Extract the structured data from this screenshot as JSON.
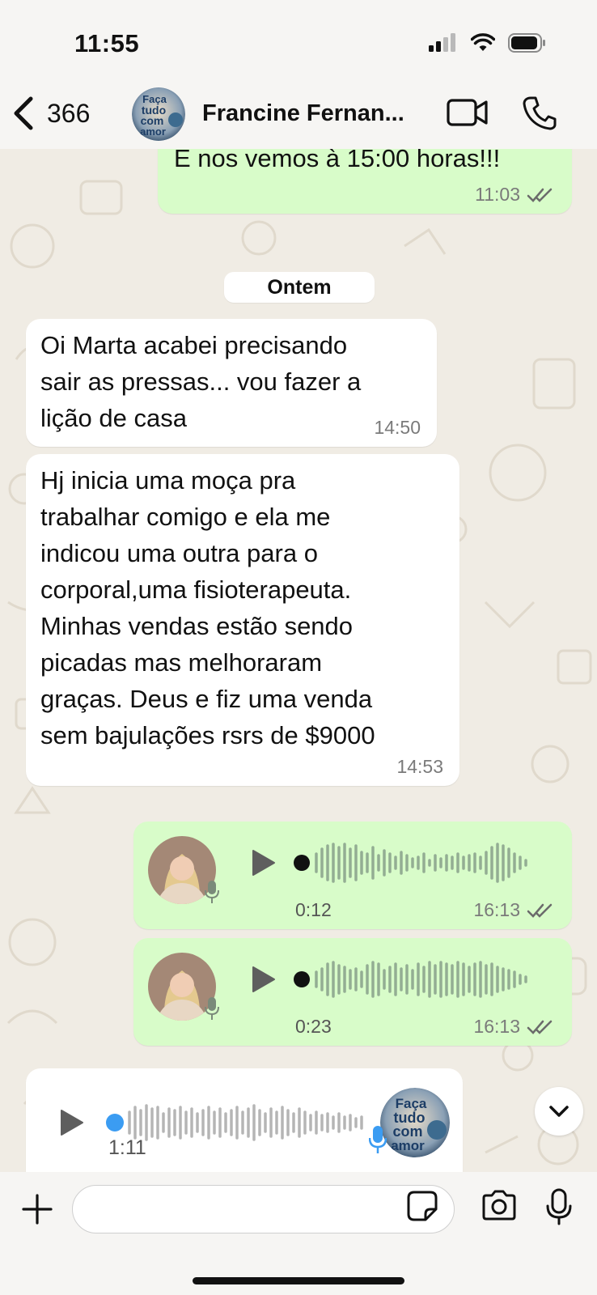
{
  "status_bar": {
    "time": "11:55"
  },
  "header": {
    "back_count": "366",
    "contact_name": "Francine Fernan...",
    "avatar_text": "Faça tudo com amor"
  },
  "messages": [
    {
      "id": "m1",
      "direction": "out",
      "text": "E nos vemos à 15:00 horas!!!",
      "time": "11:03",
      "status": "read"
    },
    {
      "id": "date",
      "label": "Ontem"
    },
    {
      "id": "m2",
      "direction": "in",
      "lines": [
        "Oi Marta acabei precisando",
        "sair as pressas... vou fazer a",
        "lição de casa"
      ],
      "time": "14:50"
    },
    {
      "id": "m3",
      "direction": "in",
      "lines": [
        "Hj inicia uma moça pra",
        "trabalhar comigo e ela me",
        "indicou uma outra para o",
        "corporal,uma fisioterapeuta.",
        "Minhas vendas estão sendo",
        "picadas mas melhoraram",
        "graças. Deus e fiz uma venda",
        "sem bajulações rsrs de $9000"
      ],
      "time": "14:53"
    },
    {
      "id": "a1",
      "direction": "out",
      "type": "audio",
      "duration": "0:12",
      "time": "16:13",
      "status": "read"
    },
    {
      "id": "a2",
      "direction": "out",
      "type": "audio",
      "duration": "0:23",
      "time": "16:13",
      "status": "read"
    },
    {
      "id": "a3",
      "direction": "in",
      "type": "audio",
      "duration": "1:11"
    }
  ],
  "input": {
    "placeholder": ""
  },
  "icons": [
    "back-chevron-icon",
    "video-call-icon",
    "phone-icon",
    "play-icon",
    "mic-icon",
    "double-check-icon",
    "chevron-down-icon",
    "plus-icon",
    "sticker-icon",
    "camera-icon"
  ],
  "colors": {
    "outgoing_bubble": "#d8fcc9",
    "incoming_bubble": "#ffffff",
    "read_check": "#6b6b6b",
    "wallpaper": "#f0ece4"
  }
}
